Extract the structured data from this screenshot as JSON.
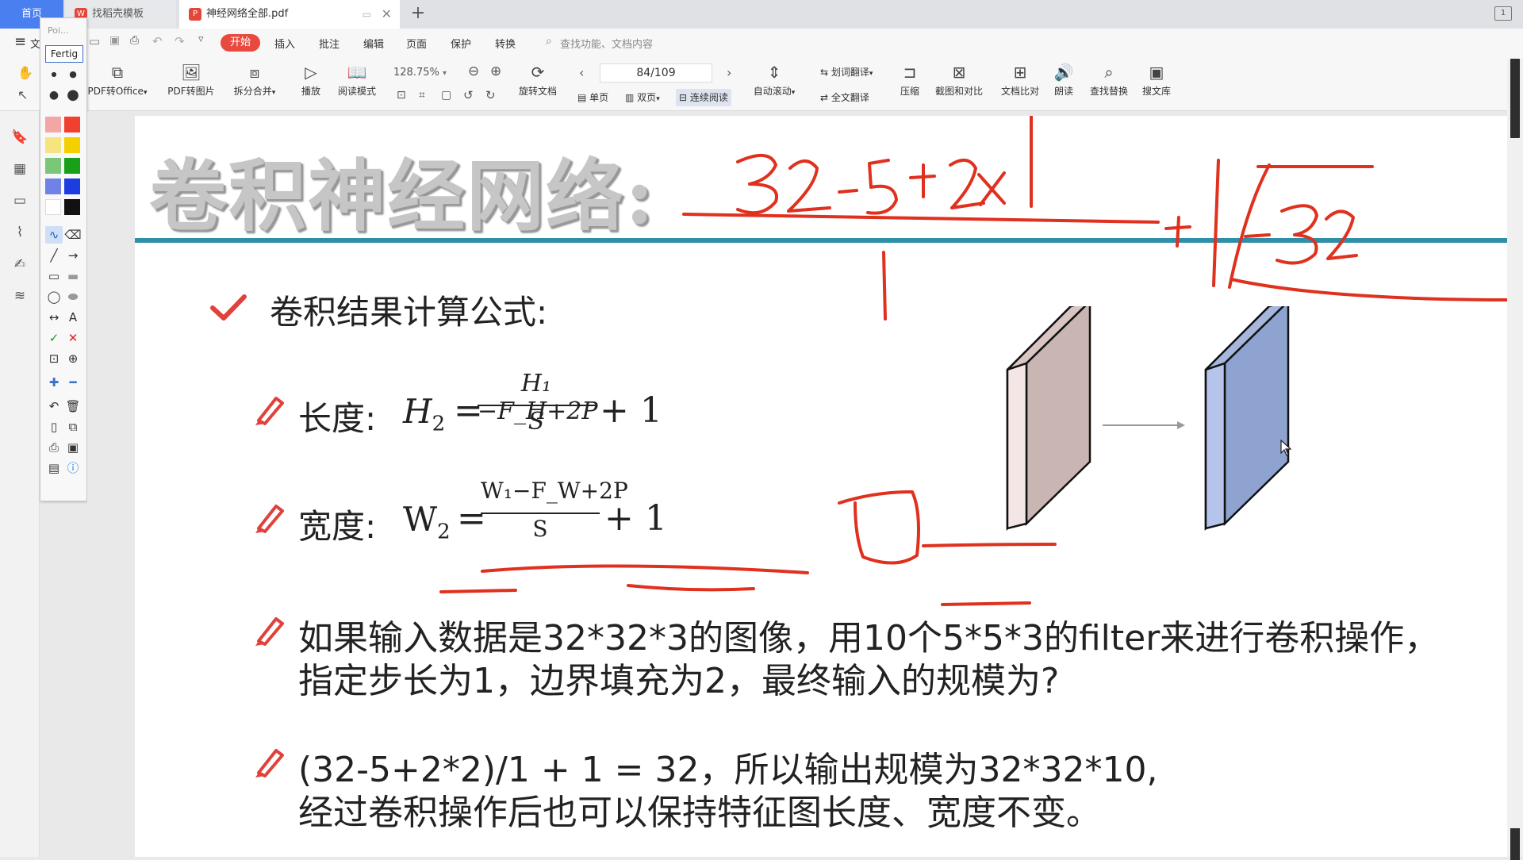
{
  "tabs": {
    "home": "首页",
    "template": "找稻壳模板",
    "document": "神经网络全部.pdf",
    "add": "+"
  },
  "menu": {
    "file": "文",
    "items": [
      "开始",
      "插入",
      "批注",
      "编辑",
      "页面",
      "保护",
      "转换"
    ],
    "search": "查找功能、文档内容"
  },
  "palette": {
    "font_name": "Poi...",
    "font_label": "Fertig",
    "swatch_colors": [
      "#f3a6a6",
      "#f04030",
      "#f5e480",
      "#f5d000",
      "#78c878",
      "#18a018",
      "#6f82e8",
      "#1d3de0",
      "#ffffff",
      "#111111"
    ]
  },
  "toolbar": {
    "pdf_to_office": "PDF转Office",
    "pdf_to_image": "PDF转图片",
    "split_merge": "拆分合并",
    "play": "播放",
    "read_mode": "阅读模式",
    "zoom": "128.75%",
    "rotate": "旋转文档",
    "page": "84/109",
    "auto_scroll": "自动滚动",
    "word_translate": "划词翻译",
    "full_translate": "全文翻译",
    "compress": "压缩",
    "screenshot_compare": "截图和对比",
    "doc_compare": "文档比对",
    "read_aloud": "朗读",
    "find_replace": "查找替换",
    "search_library": "搜文库",
    "single_page": "单页",
    "double_page": "双页",
    "continuous": "连续阅读"
  },
  "slide": {
    "title": "卷积神经网络:",
    "formula_heading": "卷积结果计算公式:",
    "height_label": "长度:",
    "height_lhs": "H",
    "height_lhs_sub": "2",
    "height_num": "H₁ −F_H+2P",
    "height_den": "S",
    "height_plus": "+ 1",
    "width_label": "宽度:",
    "width_lhs": "W",
    "width_lhs_sub": "2",
    "width_num": "W₁−F_W+2P",
    "width_den": "S",
    "width_plus": "+ 1",
    "question_line1": "如果输入数据是32*32*3的图像，用10个5*5*3的filter来进行卷积操作，",
    "question_line2": "指定步长为1，边界填充为2，最终输入的规模为?",
    "answer_line1": "(32-5+2*2)/1 + 1 = 32，所以输出规模为32*32*10,",
    "answer_line2": "经过卷积操作后也可以保持特征图长度、宽度不变。"
  },
  "ink": {
    "top_note": "32-5+2x",
    "right_note": "+1 -32"
  }
}
